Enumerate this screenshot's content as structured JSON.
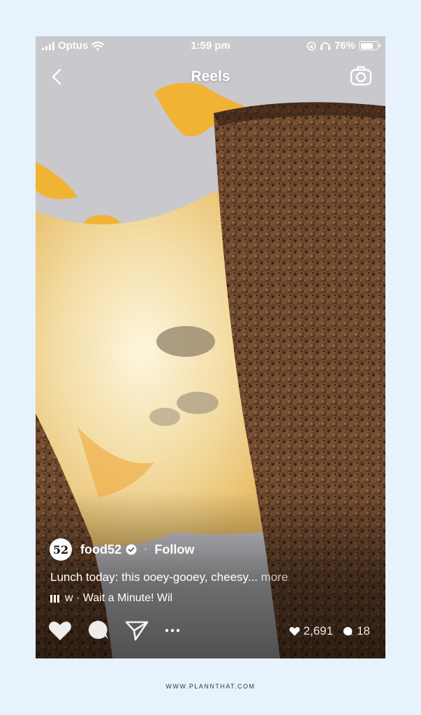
{
  "status_bar": {
    "carrier": "Optus",
    "time": "1:59 pm",
    "battery": "76%",
    "battery_level": 0.76
  },
  "header": {
    "title": "Reels"
  },
  "post": {
    "avatar_text": "52",
    "username": "food52",
    "follow_label": "Follow",
    "caption": "Lunch today: this ooey-gooey, cheesy...",
    "more_label": "more",
    "audio": "w · Wait a Minute!   Wil",
    "likes": "2,691",
    "comments": "18"
  },
  "footer": {
    "url": "WWW.PLANNTHAT.COM"
  },
  "icons": {
    "back": "chevron-left-icon",
    "camera": "camera-icon",
    "like": "heart-icon",
    "comment": "comment-icon",
    "share": "send-icon",
    "more": "ellipsis-icon"
  }
}
